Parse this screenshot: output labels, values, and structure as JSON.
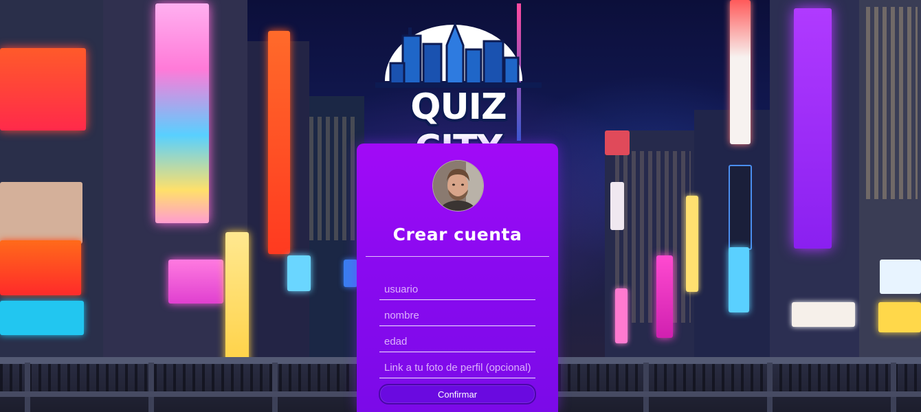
{
  "logo": {
    "text": "QUIZ CITY"
  },
  "form": {
    "title": "Crear cuenta",
    "fields": {
      "usuario_placeholder": "usuario",
      "nombre_placeholder": "nombre",
      "edad_placeholder": "edad",
      "foto_placeholder": "Link a tu foto de perfil (opcional)"
    },
    "confirm_label": "Confirmar"
  },
  "colors": {
    "card_top": "#a20af7",
    "card_bottom": "#7b0ae8",
    "button": "#6a0ae0",
    "logo_dark": "#0d1b52",
    "logo_blue": "#1f66c8"
  },
  "icons": {
    "avatar": "profile-photo"
  }
}
